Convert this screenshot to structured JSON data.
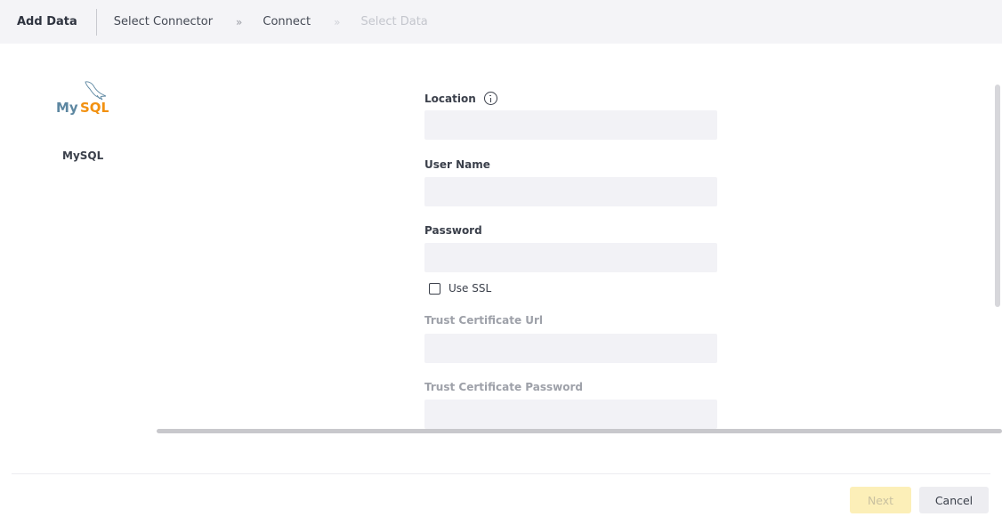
{
  "header": {
    "title": "Add Data",
    "breadcrumbs": [
      {
        "label": "Select Connector",
        "state": "active"
      },
      {
        "label": "Connect",
        "state": "active"
      },
      {
        "label": "Select Data",
        "state": "disabled"
      }
    ],
    "separator": "»"
  },
  "connector": {
    "logo_text_my": "My",
    "logo_text_sql": "SQL",
    "name": "MySQL"
  },
  "form": {
    "location_label": "Location",
    "location_value": "",
    "username_label": "User Name",
    "username_value": "",
    "password_label": "Password",
    "password_value": "",
    "use_ssl_label": "Use SSL",
    "use_ssl_checked": false,
    "trust_cert_url_label": "Trust Certificate Url",
    "trust_cert_url_value": "",
    "trust_cert_password_label": "Trust Certificate Password",
    "trust_cert_password_value": ""
  },
  "footer": {
    "next_label": "Next",
    "cancel_label": "Cancel"
  },
  "colors": {
    "header_bg": "#f4f4f7",
    "input_bg": "#f2f2f6",
    "next_bg": "#fcefb8",
    "mysql_blue": "#5d87a1",
    "mysql_orange": "#f29111"
  }
}
